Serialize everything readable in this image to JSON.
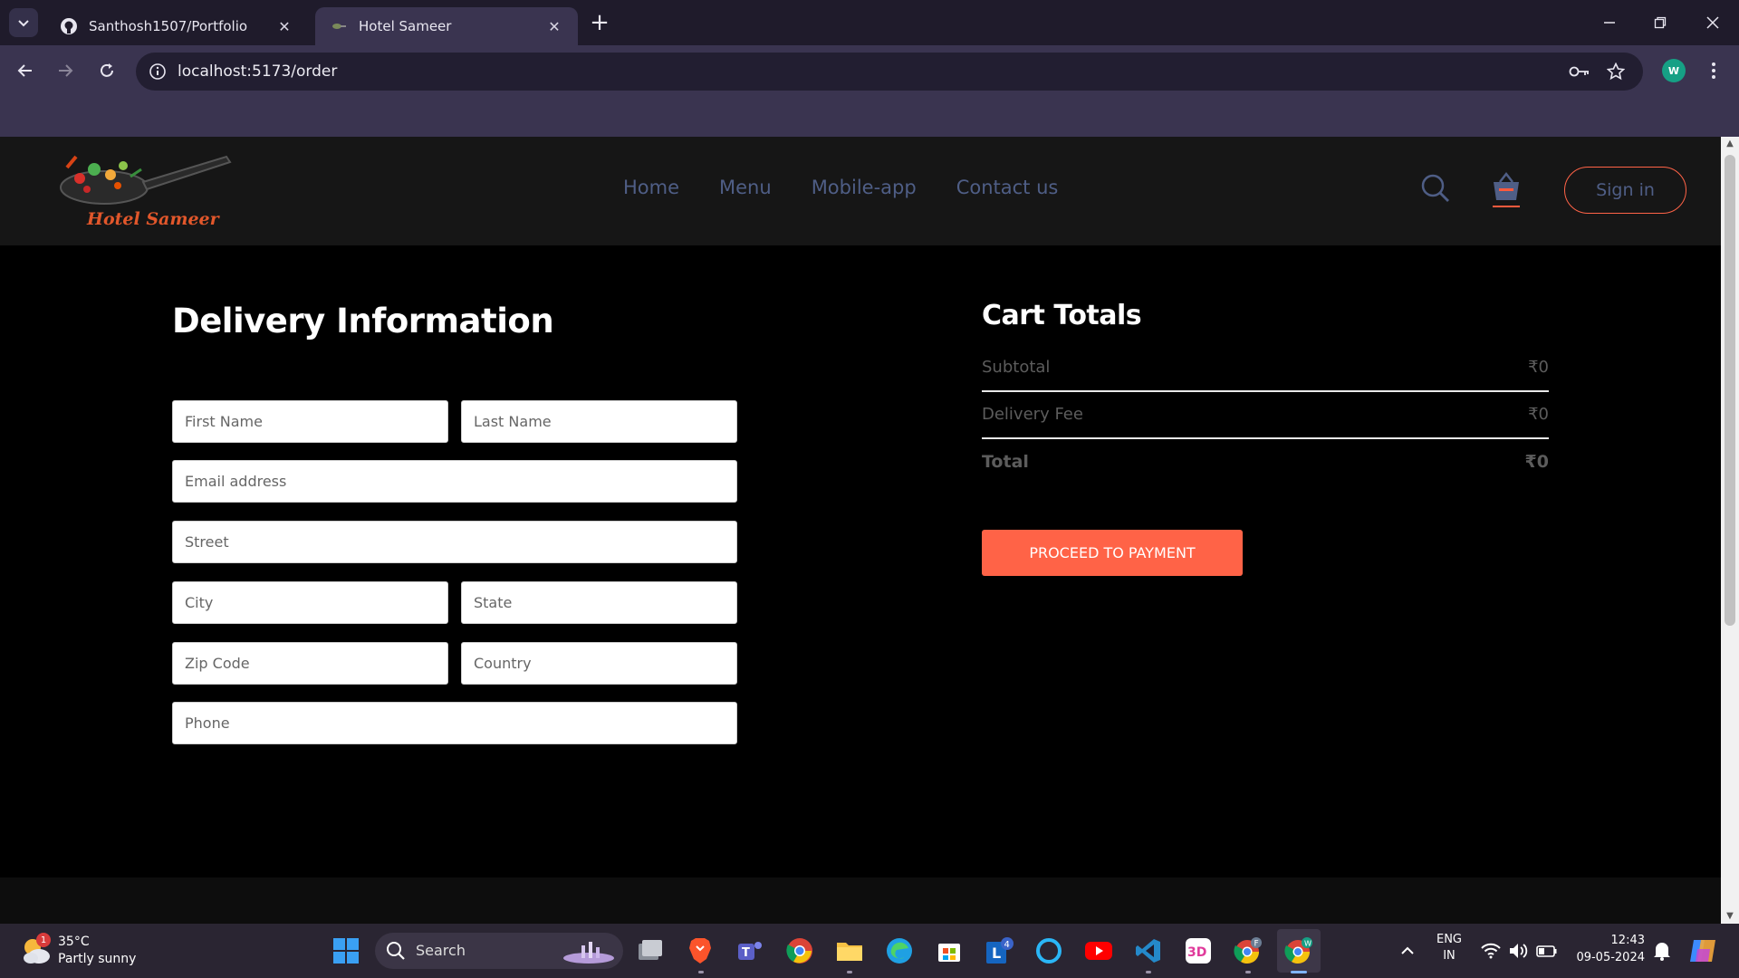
{
  "browser": {
    "tabs": [
      {
        "title": "Santhosh1507/Portfolio",
        "icon": "github-icon",
        "active": false
      },
      {
        "title": "Hotel Sameer",
        "icon": "site-favicon",
        "active": true
      }
    ],
    "url": "localhost:5173/order",
    "profile_initial": "W"
  },
  "site": {
    "logo_text": "Hotel Sameer",
    "nav": [
      "Home",
      "Menu",
      "Mobile-app",
      "Contact us"
    ],
    "signin_label": "Sign in",
    "accent": "#ff6347",
    "nav_color": "#4f5e86"
  },
  "delivery": {
    "title": "Delivery Information",
    "first_name": "First Name",
    "last_name": "Last Name",
    "email": "Email address",
    "street": "Street",
    "city": "City",
    "state": "State",
    "zip": "Zip Code",
    "country": "Country",
    "phone": "Phone"
  },
  "cart": {
    "title": "Cart Totals",
    "subtotal_label": "Subtotal",
    "subtotal_value": "₹0",
    "delivery_label": "Delivery Fee",
    "delivery_value": "₹0",
    "total_label": "Total",
    "total_value": "₹0",
    "button": "PROCEED TO PAYMENT"
  },
  "taskbar": {
    "weather_temp": "35°C",
    "weather_desc": "Partly sunny",
    "weather_badge": "1",
    "search_label": "Search",
    "lang_line1": "ENG",
    "lang_line2": "IN",
    "time": "12:43",
    "date": "09-05-2024",
    "outlook_badge": "4",
    "chrome_f_badge": "F",
    "chrome_w_badge": "W",
    "app_3d_label": "3D"
  }
}
